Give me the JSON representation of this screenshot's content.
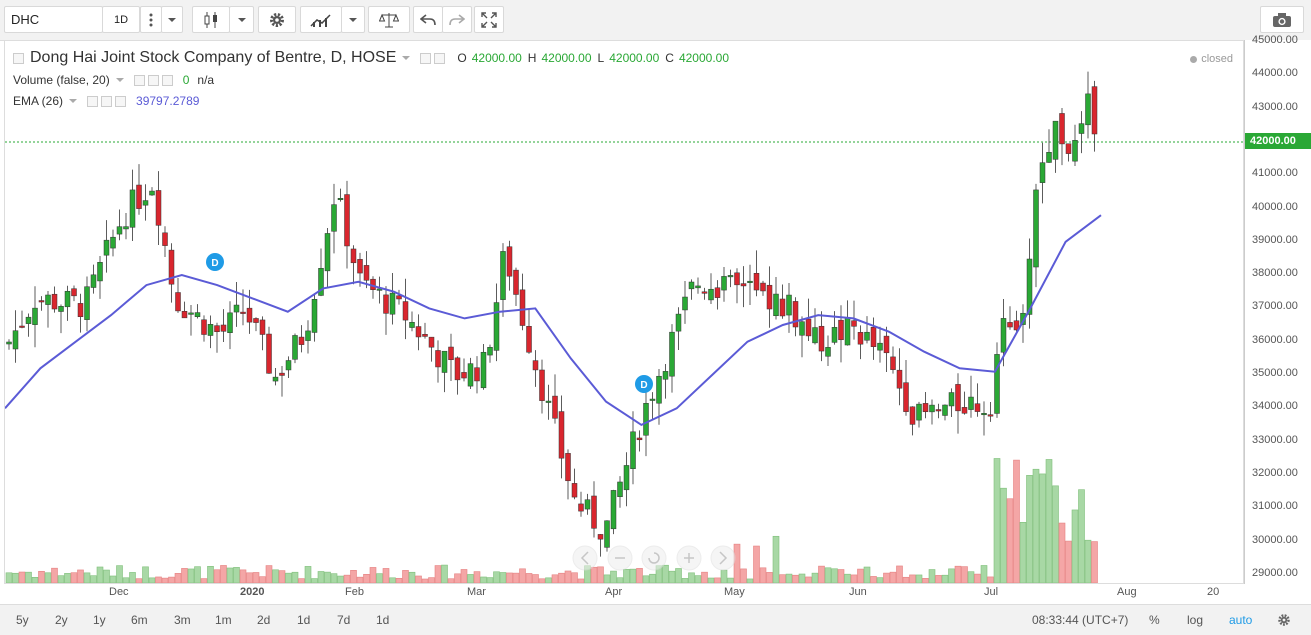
{
  "toolbar": {
    "symbol": "DHC",
    "interval": "1D",
    "icons": [
      "candles-icon",
      "settings-gear-icon",
      "indicators-icon",
      "compare-icon",
      "undo-icon",
      "redo-icon",
      "fullscreen-icon",
      "camera-icon"
    ]
  },
  "legend": {
    "title": "Dong Hai Joint Stock Company of Bentre, D, HOSE",
    "o_label": "O",
    "o": "42000.00",
    "h_label": "H",
    "h": "42000.00",
    "l_label": "L",
    "l": "42000.00",
    "c_label": "C",
    "c": "42000.00",
    "volume_label": "Volume (false, 20)",
    "volume_value": "0",
    "volume_na": "n/a",
    "ema_label": "EMA (26)",
    "ema_value": "39797.2789",
    "status": "closed"
  },
  "price_scale": {
    "labels": [
      "45000.00",
      "44000.00",
      "43000.00",
      "42000.00",
      "41000.00",
      "40000.00",
      "39000.00",
      "38000.00",
      "37000.00",
      "36000.00",
      "35000.00",
      "34000.00",
      "33000.00",
      "32000.00",
      "31000.00",
      "30000.00",
      "29000.00"
    ],
    "current": "42000.00"
  },
  "time_axis": [
    "Dec",
    "2020",
    "Feb",
    "Mar",
    "Apr",
    "May",
    "Jun",
    "Jul",
    "Aug",
    "20"
  ],
  "bottom": {
    "periods": [
      "5y",
      "2y",
      "1y",
      "6m",
      "3m",
      "1m",
      "2d",
      "1d",
      "7d",
      "1d"
    ],
    "time": "08:33:44 (UTC+7)",
    "percent": "%",
    "log": "log",
    "auto": "auto"
  },
  "markers": [
    "D",
    "D"
  ],
  "colors": {
    "up": "#2aa835",
    "down": "#d9262e",
    "ema": "#5b5bd6",
    "accent": "#1f9be6"
  },
  "chart_data": {
    "type": "candlestick",
    "ylim": [
      29000,
      45000
    ],
    "price_scale_ticks": [
      45000,
      44000,
      43000,
      42000,
      41000,
      40000,
      39000,
      38000,
      37000,
      36000,
      35000,
      34000,
      33000,
      32000,
      31000,
      30000,
      29000
    ],
    "current_price": 42000,
    "series": [
      {
        "name": "EMA (26)",
        "last": 39797.2789,
        "values": [
          34000,
          35200,
          36000,
          36800,
          37700,
          38000,
          37700,
          37300,
          36900,
          37600,
          37800,
          37500,
          37000,
          36700,
          36900,
          37000,
          35500,
          34200,
          33500,
          34000,
          35000,
          36000,
          36500,
          36800,
          36700,
          36300,
          35700,
          35200,
          35100,
          37000,
          39000,
          39800
        ]
      }
    ]
  }
}
